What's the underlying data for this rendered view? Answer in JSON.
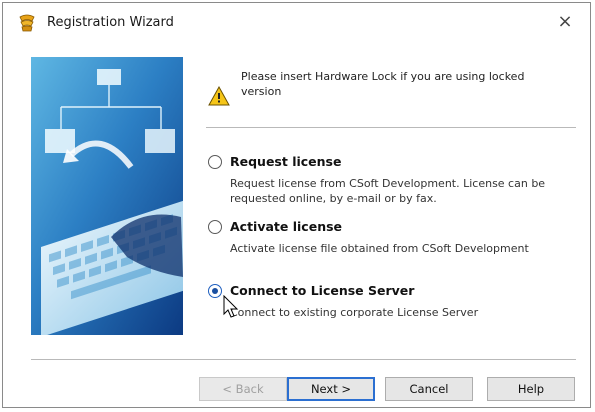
{
  "window": {
    "title": "Registration Wizard",
    "close_glyph": "×"
  },
  "notice": {
    "text": "Please insert Hardware Lock if you are using locked version",
    "icon": "warning-icon"
  },
  "options": [
    {
      "label": "Request license",
      "description": "Request license from CSoft Development. License can be requested online, by e-mail or by fax.",
      "selected": false
    },
    {
      "label": "Activate license",
      "description": "Activate license file obtained from CSoft Development",
      "selected": false
    },
    {
      "label": "Connect to License Server",
      "description": "Connect to existing corporate License Server",
      "selected": true
    }
  ],
  "buttons": {
    "back": "< Back",
    "next": "Next >",
    "cancel": "Cancel",
    "help": "Help"
  },
  "colors": {
    "accent": "#2b6fd1",
    "hero_dark": "#0f3e8a",
    "hero_light": "#bfe6f7"
  }
}
